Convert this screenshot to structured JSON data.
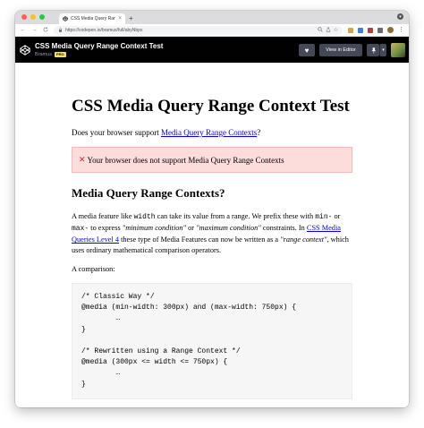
{
  "browser": {
    "tab_title": "CSS Media Query Range Cont",
    "tab_close": "×",
    "new_tab": "+",
    "url": "https://codepen.io/bramus/full/abyNbpx",
    "back": "←",
    "forward": "→",
    "reload": "C"
  },
  "codepen": {
    "title": "CSS Media Query Range Context Test",
    "author": "Bramus",
    "pro_badge": "PRO",
    "heart": "♥",
    "view_in_editor": "View in Editor",
    "pin": "📌",
    "caret": "▾"
  },
  "page": {
    "heading": "CSS Media Query Range Context Test",
    "question_prefix": "Does your browser support ",
    "question_link": "Media Query Range Contexts",
    "question_suffix": "?",
    "notice_icon": "✕",
    "notice_text": "Your browser does not support Media Query Range Contexts",
    "subheading": "Media Query Range Contexts?",
    "para": {
      "t1": "A media feature like ",
      "c1": "width",
      "t2": " can take its value from a range. We prefix these with ",
      "c2": "min-",
      "t3": " or ",
      "c3": "max-",
      "t4": " to express ",
      "e1": "\"minimum condition\"",
      "t5": " or ",
      "e2": "\"maximum condition\"",
      "t6": " constraints. In ",
      "link": "CSS Media Queries Level 4",
      "t7": " these type of Media Features can now be written as a ",
      "e3": "\"range context\"",
      "t8": ", which uses ordinary mathematical comparison operators."
    },
    "comparison_label": "A comparison:",
    "code_lines": [
      "/* Classic Way */",
      "@media (min-width: 300px) and (max-width: 750px) {",
      "        …",
      "}",
      "",
      "/* Rewritten using a Range Context */",
      "@media (300px <= width <= 750px) {",
      "        …",
      "}"
    ]
  }
}
